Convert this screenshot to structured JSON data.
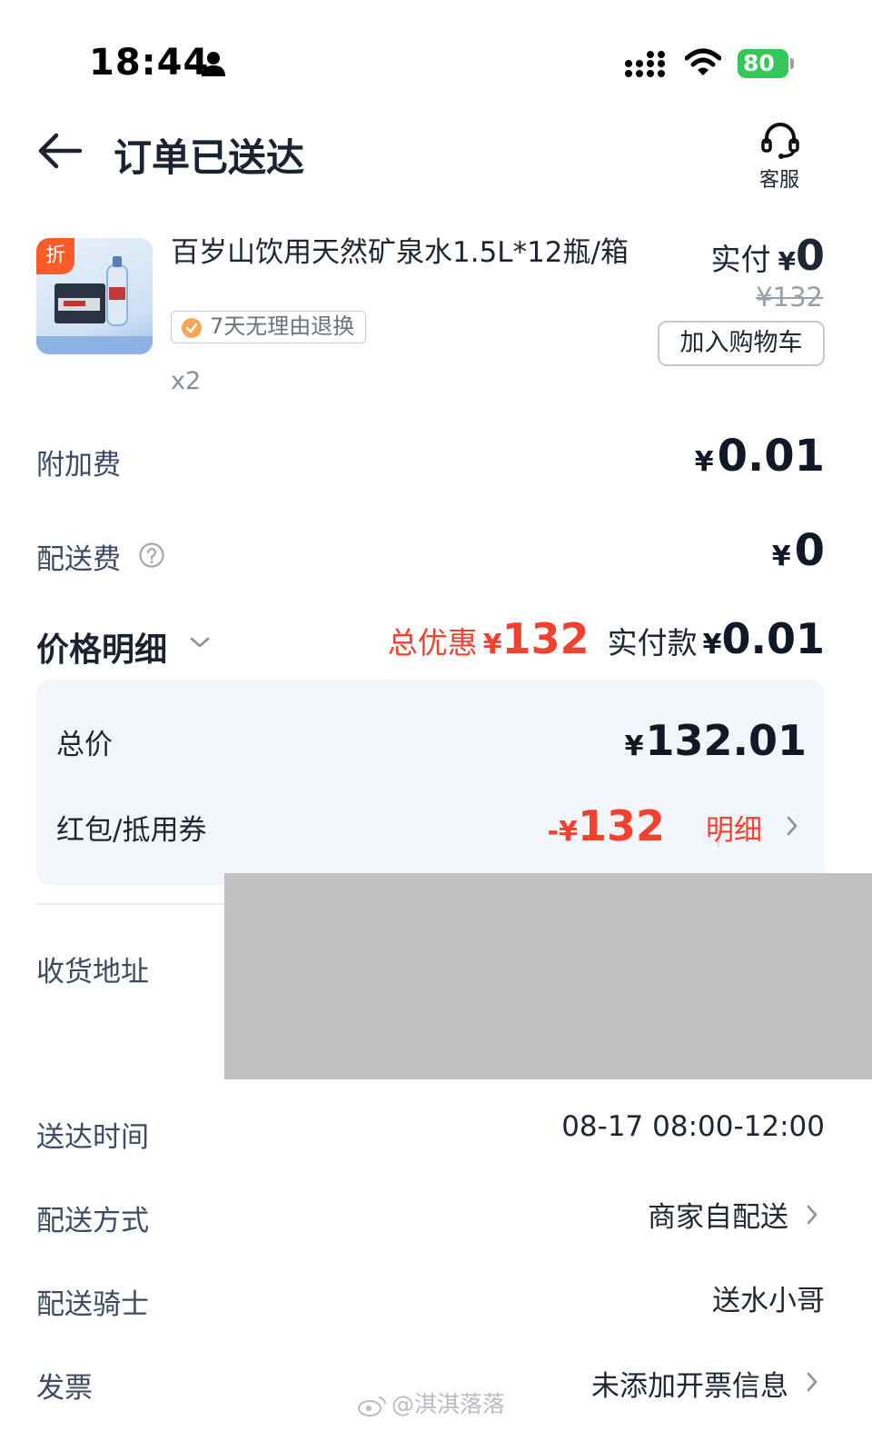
{
  "status_bar": {
    "time": "18:44",
    "battery": "80"
  },
  "header": {
    "title": "订单已送达",
    "customer_service": "客服"
  },
  "product": {
    "badge": "折",
    "name": "百岁山饮用天然矿泉水1.5L*12瓶/箱",
    "return_policy": "7天无理由退换",
    "quantity": "x2",
    "paid_label": "实付",
    "paid_currency": "¥",
    "paid_amount": "0",
    "original_price": "¥132",
    "add_to_cart": "加入购物车"
  },
  "fees": {
    "surcharge_label": "附加费",
    "surcharge_currency": "¥",
    "surcharge_amount": "0.01",
    "delivery_label": "配送费",
    "delivery_currency": "¥",
    "delivery_amount": "0"
  },
  "price_detail": {
    "title": "价格明细",
    "discount_label": "总优惠",
    "discount_currency": "¥",
    "discount_amount": "132",
    "pay_label": "实付款",
    "pay_currency": "¥",
    "pay_amount": "0.01",
    "total_label": "总价",
    "total_currency": "¥",
    "total_amount": "132.01",
    "coupon_label": "红包/抵用券",
    "coupon_prefix": "-¥",
    "coupon_amount": "132",
    "detail_link": "明细"
  },
  "order_info": {
    "address_label": "收货地址",
    "delivery_time_label": "送达时间",
    "delivery_time_value": "08-17 08:00-12:00",
    "delivery_method_label": "配送方式",
    "delivery_method_value": "商家自配送",
    "rider_label": "配送骑士",
    "rider_value": "送水小哥",
    "invoice_label": "发票",
    "invoice_value": "未添加开票信息"
  },
  "watermark": "@淇淇落落",
  "colors": {
    "accent_red": "#f2412f",
    "badge_orange": "#ff5b2a",
    "battery_green": "#34c759",
    "card_bg": "#f2f5f9",
    "label_text": "#3d4a63"
  },
  "icons": [
    "person-icon",
    "signal-icon",
    "wifi-icon",
    "back-arrow-icon",
    "headset-icon",
    "check-badge-icon",
    "help-icon",
    "chevron-down-icon",
    "chevron-right-icon",
    "weibo-icon"
  ]
}
